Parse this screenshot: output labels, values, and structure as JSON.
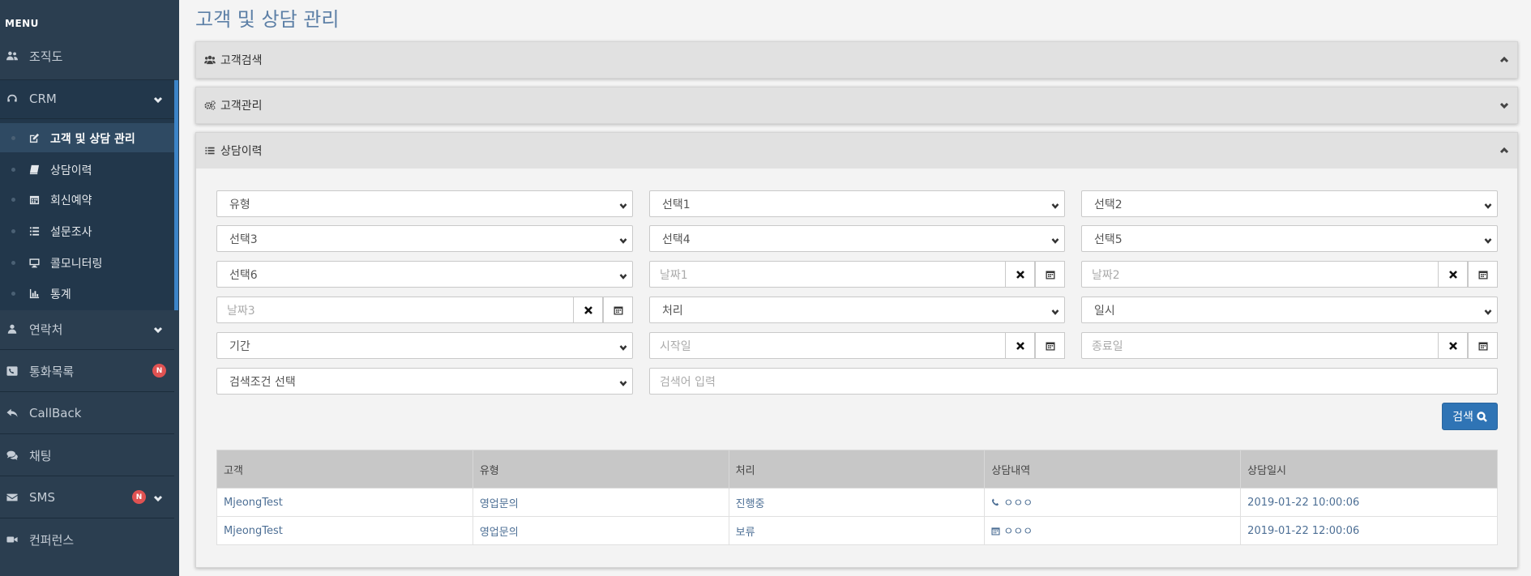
{
  "sidebar": {
    "menu_title": "MENU",
    "items": [
      {
        "label": "조직도",
        "icon": "users-icon"
      },
      {
        "label": "CRM",
        "icon": "headset-icon"
      },
      {
        "label": "연락처",
        "icon": "user-icon"
      },
      {
        "label": "통화목록",
        "icon": "phone-square-icon",
        "badge": "N"
      },
      {
        "label": "CallBack",
        "icon": "reply-icon"
      },
      {
        "label": "채팅",
        "icon": "comments-icon"
      },
      {
        "label": "SMS",
        "icon": "envelope-icon",
        "badge": "N"
      },
      {
        "label": "컨퍼런스",
        "icon": "video-camera-icon"
      }
    ],
    "crm_sub": [
      {
        "label": "고객 및 상담 관리",
        "icon": "edit-icon",
        "active": true
      },
      {
        "label": "상담이력",
        "icon": "book-icon"
      },
      {
        "label": "회신예약",
        "icon": "calendar-icon"
      },
      {
        "label": "설문조사",
        "icon": "list-icon"
      },
      {
        "label": "콜모니터링",
        "icon": "desktop-icon"
      },
      {
        "label": "통계",
        "icon": "bar-chart-icon"
      }
    ]
  },
  "page": {
    "title": "고객 및 상담 관리"
  },
  "panels": [
    {
      "title": "고객검색",
      "icon": "users-icon",
      "expanded": true
    },
    {
      "title": "고객관리",
      "icon": "cogs-icon",
      "expanded": false
    },
    {
      "title": "상담이력",
      "icon": "list-icon",
      "expanded": true
    }
  ],
  "filters": {
    "type": "유형",
    "select1": "선택1",
    "select2": "선택2",
    "select3": "선택3",
    "select4": "선택4",
    "select5": "선택5",
    "select6": "선택6",
    "date1_placeholder": "날짜1",
    "date2_placeholder": "날짜2",
    "date3_placeholder": "날짜3",
    "process": "처리",
    "datetime": "일시",
    "period": "기간",
    "start_placeholder": "시작일",
    "end_placeholder": "종료일",
    "condition": "검색조건 선택",
    "keyword_placeholder": "검색어 입력",
    "search_label": "검색"
  },
  "table": {
    "headers": [
      "고객",
      "유형",
      "처리",
      "상담내역",
      "상담일시"
    ],
    "rows": [
      {
        "customer": "MjeongTest",
        "type": "영업문의",
        "process": "진행중",
        "detail_icon": "phone-icon",
        "detail": "ㅇㅇㅇ",
        "datetime": "2019-01-22 10:00:06"
      },
      {
        "customer": "MjeongTest",
        "type": "영업문의",
        "process": "보류",
        "detail_icon": "calendar-icon",
        "detail": "ㅇㅇㅇ",
        "datetime": "2019-01-22 12:00:06"
      }
    ]
  },
  "colors": {
    "sidebar": "#2b3e50",
    "accent": "#3c84c8",
    "button": "#2f74b5",
    "badge": "#e05252"
  }
}
